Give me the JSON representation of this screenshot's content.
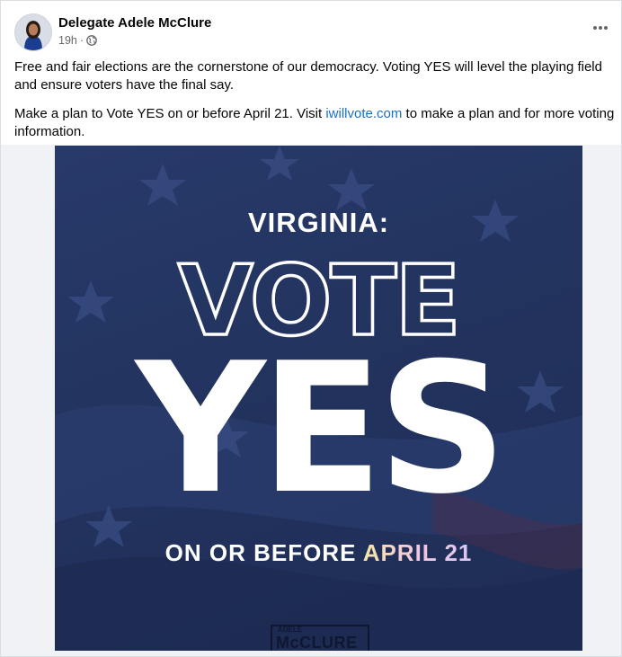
{
  "post": {
    "author": "Delegate Adele McClure",
    "time": "19h",
    "separator": "·",
    "more_icon": "more-horizontal-icon",
    "privacy_icon": "globe-icon",
    "paragraph1": "Free and fair elections are the cornerstone of our democracy. Voting YES will level the playing field and ensure voters have the final say.",
    "paragraph2_before": "Make a plan to Vote YES on or before April 21. Visit ",
    "paragraph2_link": "iwillvote.com",
    "paragraph2_after": " to make a plan and for more voting information."
  },
  "poster": {
    "state": "VIRGINIA:",
    "vote": "VOTE",
    "yes": "YES",
    "date_prefix": "ON OR BEFORE ",
    "date_accent": "APRIL 21",
    "logo_small": "ADELE",
    "logo_big": "McCLURE"
  },
  "colors": {
    "poster_bg": "#22335e",
    "link": "#1a6fc9",
    "meta": "#65676b"
  }
}
